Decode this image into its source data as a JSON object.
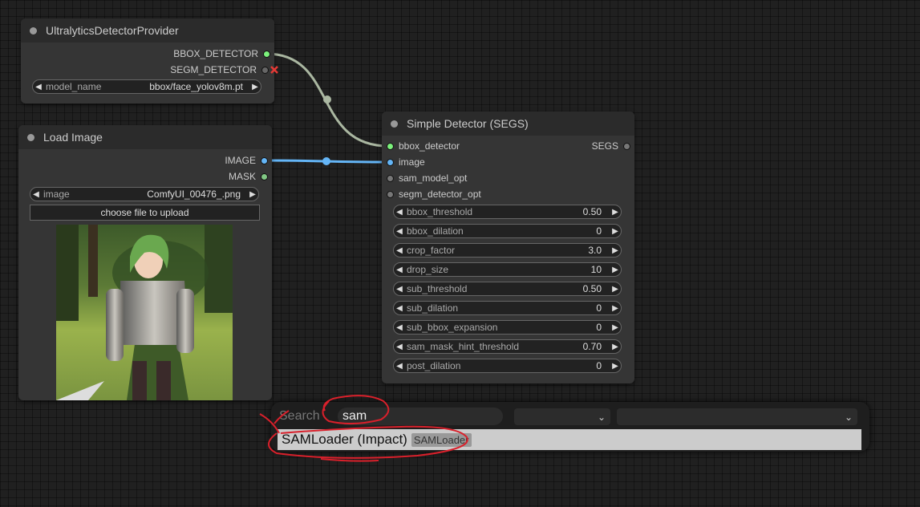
{
  "nodes": {
    "ultralytics": {
      "title": "UltralyticsDetectorProvider",
      "outputs": [
        "BBOX_DETECTOR",
        "SEGM_DETECTOR"
      ],
      "widget": {
        "label": "model_name",
        "value": "bbox/face_yolov8m.pt"
      }
    },
    "load_image": {
      "title": "Load Image",
      "outputs": [
        "IMAGE",
        "MASK"
      ],
      "widget": {
        "label": "image",
        "value": "ComfyUI_00476_.png"
      },
      "upload_label": "choose file to upload"
    },
    "simple_detector": {
      "title": "Simple Detector (SEGS)",
      "inputs": [
        "bbox_detector",
        "image",
        "sam_model_opt",
        "segm_detector_opt"
      ],
      "output": "SEGS",
      "widgets": [
        {
          "label": "bbox_threshold",
          "value": "0.50"
        },
        {
          "label": "bbox_dilation",
          "value": "0"
        },
        {
          "label": "crop_factor",
          "value": "3.0"
        },
        {
          "label": "drop_size",
          "value": "10"
        },
        {
          "label": "sub_threshold",
          "value": "0.50"
        },
        {
          "label": "sub_dilation",
          "value": "0"
        },
        {
          "label": "sub_bbox_expansion",
          "value": "0"
        },
        {
          "label": "sam_mask_hint_threshold",
          "value": "0.70"
        },
        {
          "label": "post_dilation",
          "value": "0"
        }
      ]
    }
  },
  "search": {
    "label": "Search",
    "value": "sam",
    "result_name": "SAMLoader (Impact)",
    "result_tag": "SAMLoader"
  },
  "colors": {
    "bbox_slot": "#7cf27c",
    "image_slot": "#64b5f6",
    "mask_slot": "#81c784",
    "link_bbox": "#aab7a1",
    "link_image": "#64b5f6",
    "annotation": "#d9202b"
  }
}
